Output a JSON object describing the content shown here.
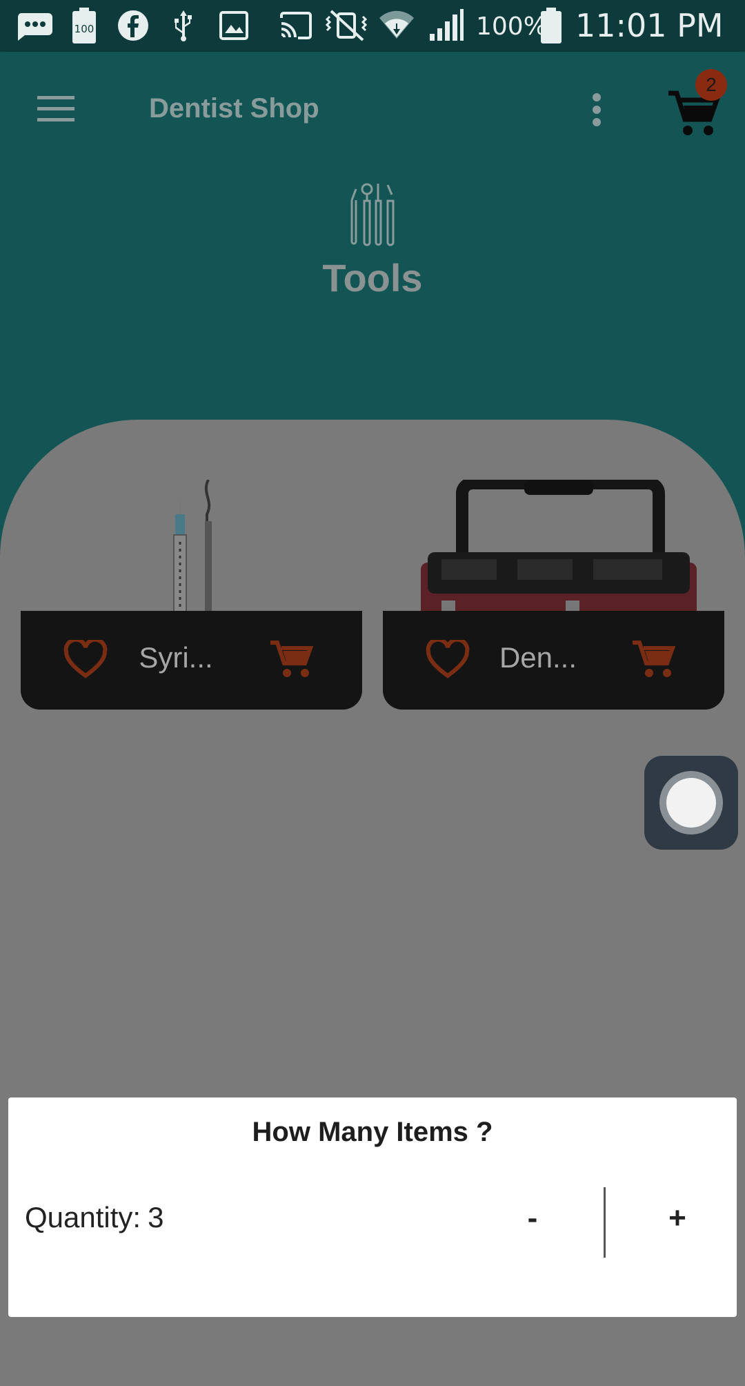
{
  "status_bar": {
    "battery_percent": "100%",
    "time": "11:01 PM",
    "icons": [
      "message-icon",
      "battery-100-icon",
      "facebook-icon",
      "usb-icon",
      "image-icon",
      "cast-icon",
      "vibrate-off-icon",
      "wifi-icon",
      "signal-icon",
      "battery-icon"
    ]
  },
  "app_bar": {
    "title": "Dentist Shop",
    "cart_count": "2",
    "category_icon": "dental-tools-icon",
    "category_title": "Tools"
  },
  "products": [
    {
      "name": "Syri...",
      "image": "syringe-and-probe"
    },
    {
      "name": "Den...",
      "image": "dental-toolbox"
    }
  ],
  "dialog": {
    "title": "How Many Items ?",
    "quantity_label": "Quantity:",
    "quantity_value": "3",
    "minus_label": "-",
    "plus_label": "+"
  },
  "colors": {
    "app_bar": "#135555",
    "status_bar": "#0d3b3b",
    "accent": "#b5451b",
    "scrim": "#7a7a7a"
  }
}
